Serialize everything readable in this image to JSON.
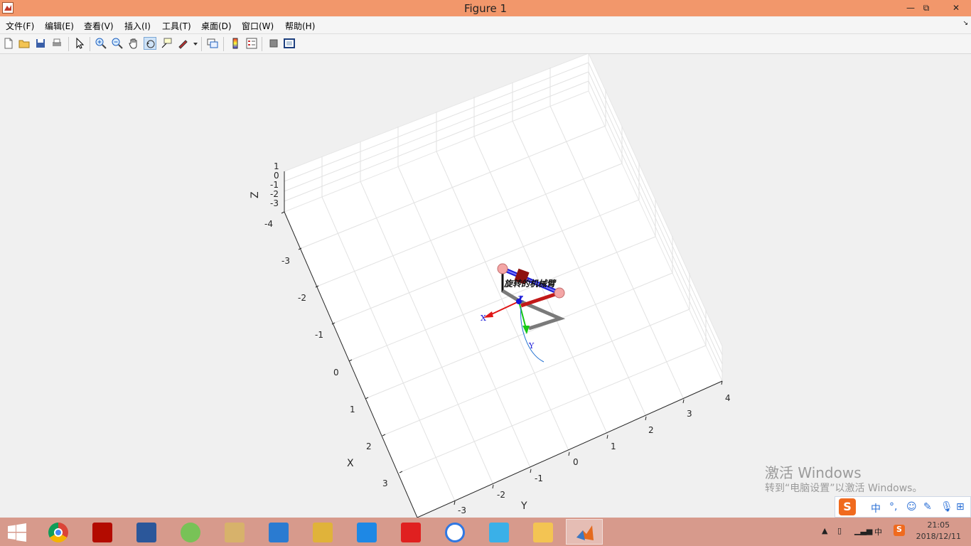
{
  "window": {
    "title": "Figure 1",
    "minimize": "—",
    "restore": "⧉",
    "close": "✕"
  },
  "menu": [
    "文件(F)",
    "编辑(E)",
    "查看(V)",
    "插入(I)",
    "工具(T)",
    "桌面(D)",
    "窗口(W)",
    "帮助(H)"
  ],
  "menu_overflow": "↘",
  "toolbar": {
    "buttons": [
      "new-figure",
      "open-file",
      "save-figure",
      "print-figure",
      "edit-plot",
      "zoom-in",
      "zoom-out",
      "pan",
      "rotate-3d",
      "data-cursor",
      "brush",
      "link-plot",
      "insert-colorbar",
      "insert-legend",
      "hide-plot-tools",
      "show-plot-tools"
    ],
    "active": "rotate-3d"
  },
  "plot": {
    "axis_labels": {
      "x": "X",
      "y": "Y",
      "z": "Z"
    },
    "x_ticks": [
      "-4",
      "-3",
      "-2",
      "-1",
      "0",
      "1",
      "2",
      "3"
    ],
    "y_ticks": [
      "-3",
      "-2",
      "-1",
      "0",
      "1",
      "2",
      "3",
      "4"
    ],
    "z_ticks": [
      "1",
      "0",
      "-1",
      "-2",
      "-3"
    ],
    "robot_label": "旋转的机械臂",
    "frame_labels": {
      "x": "X",
      "y": "Y",
      "z": "Z"
    },
    "colors": {
      "link_blue": "#1a1ad4",
      "link_red": "#c21818",
      "link_gray": "#7a7a7a",
      "joint": "#f4a6a6",
      "axis_x": "#e01515",
      "axis_y": "#15c815",
      "axis_z": "#1515d8",
      "trajectory": "#1f6fd1"
    }
  },
  "watermark": {
    "line1": "激活 Windows",
    "line2": "转到“电脑设置”以激活 Windows。"
  },
  "ime": {
    "items": [
      "中",
      "°,",
      "☺",
      "✎",
      "🎙",
      "⊞"
    ]
  },
  "taskbar": {
    "apps": [
      "chrome-icon",
      "acrobat-icon",
      "word-icon",
      "android-studio-icon",
      "autocad-icon",
      "mathtype-icon",
      "jenga-icon",
      "microsoft-planner-icon",
      "youdao-icon",
      "baidu-netdisk-icon",
      "network-icon",
      "file-explorer-icon",
      "matlab-icon"
    ],
    "active_app": "matlab-icon"
  },
  "tray": {
    "lang": "中",
    "time": "21:05",
    "date": "2018/12/11"
  }
}
